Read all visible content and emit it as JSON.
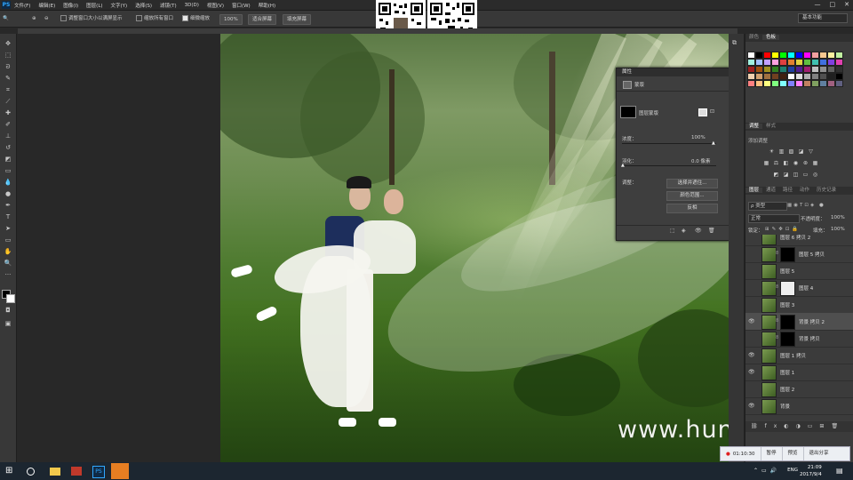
{
  "app": {
    "logo": "PS"
  },
  "menu": [
    "文件(F)",
    "编辑(E)",
    "图像(I)",
    "图层(L)",
    "文字(Y)",
    "选择(S)",
    "滤镜(T)",
    "3D(D)",
    "视图(V)",
    "窗口(W)",
    "帮助(H)"
  ],
  "window_controls": [
    "—",
    "□",
    "✕"
  ],
  "options_bar": {
    "resize_label": "调整窗口大小以满屏显示",
    "zoom_all_label": "缩放所有窗口",
    "scrubby_label": "细微缩放",
    "zoom_value": "100%",
    "fit_screen": "适合屏幕",
    "fill_screen": "填充屏幕",
    "workspace": "基本功能"
  },
  "properties": {
    "tab": "属性",
    "section": "蒙版",
    "mask_type": "图层蒙版",
    "density_label": "浓度：",
    "density_value": "100%",
    "feather_label": "羽化：",
    "feather_value": "0.0 像素",
    "adjust_label": "调整：",
    "btn_select_mask": "选择并遮住...",
    "btn_color_range": "颜色范围...",
    "btn_invert": "反相"
  },
  "swatches_tabs": [
    "颜色",
    "色板"
  ],
  "adjust_tabs": [
    "调整",
    "样式"
  ],
  "adjust_add": "添加调整",
  "layers_tabs": [
    "图层",
    "通道",
    "路径",
    "动作",
    "历史记录"
  ],
  "layers": {
    "filter_kind": "ρ 类型",
    "blend_mode": "正常",
    "opacity_label": "不透明度：",
    "opacity_value": "100%",
    "lock_label": "锁定：",
    "fill_label": "填充：",
    "fill_value": "100%",
    "items": [
      {
        "name": "图层 6 拷贝 2",
        "visible": false,
        "mask": false
      },
      {
        "name": "图层 5 拷贝",
        "visible": false,
        "mask": "black"
      },
      {
        "name": "图层 5",
        "visible": false,
        "mask": false
      },
      {
        "name": "图层 4",
        "visible": false,
        "mask": "white"
      },
      {
        "name": "图层 3",
        "visible": false,
        "mask": false
      },
      {
        "name": "背景 拷贝 2",
        "visible": true,
        "mask": "black",
        "selected": true
      },
      {
        "name": "背景 拷贝",
        "visible": false,
        "mask": "black"
      },
      {
        "name": "图层 1 拷贝",
        "visible": true,
        "mask": false
      },
      {
        "name": "图层 1",
        "visible": true,
        "mask": false
      },
      {
        "name": "图层 2",
        "visible": false,
        "mask": false
      },
      {
        "name": "背景",
        "visible": true,
        "mask": false
      }
    ]
  },
  "recording": {
    "time": "01:10:30",
    "pause": "暂停",
    "preview": "预览",
    "exit": "退出分享"
  },
  "watermark": "www.hunls.com",
  "clock": {
    "time": "21:09",
    "date": "2017/9/4",
    "ime": "ENG"
  }
}
